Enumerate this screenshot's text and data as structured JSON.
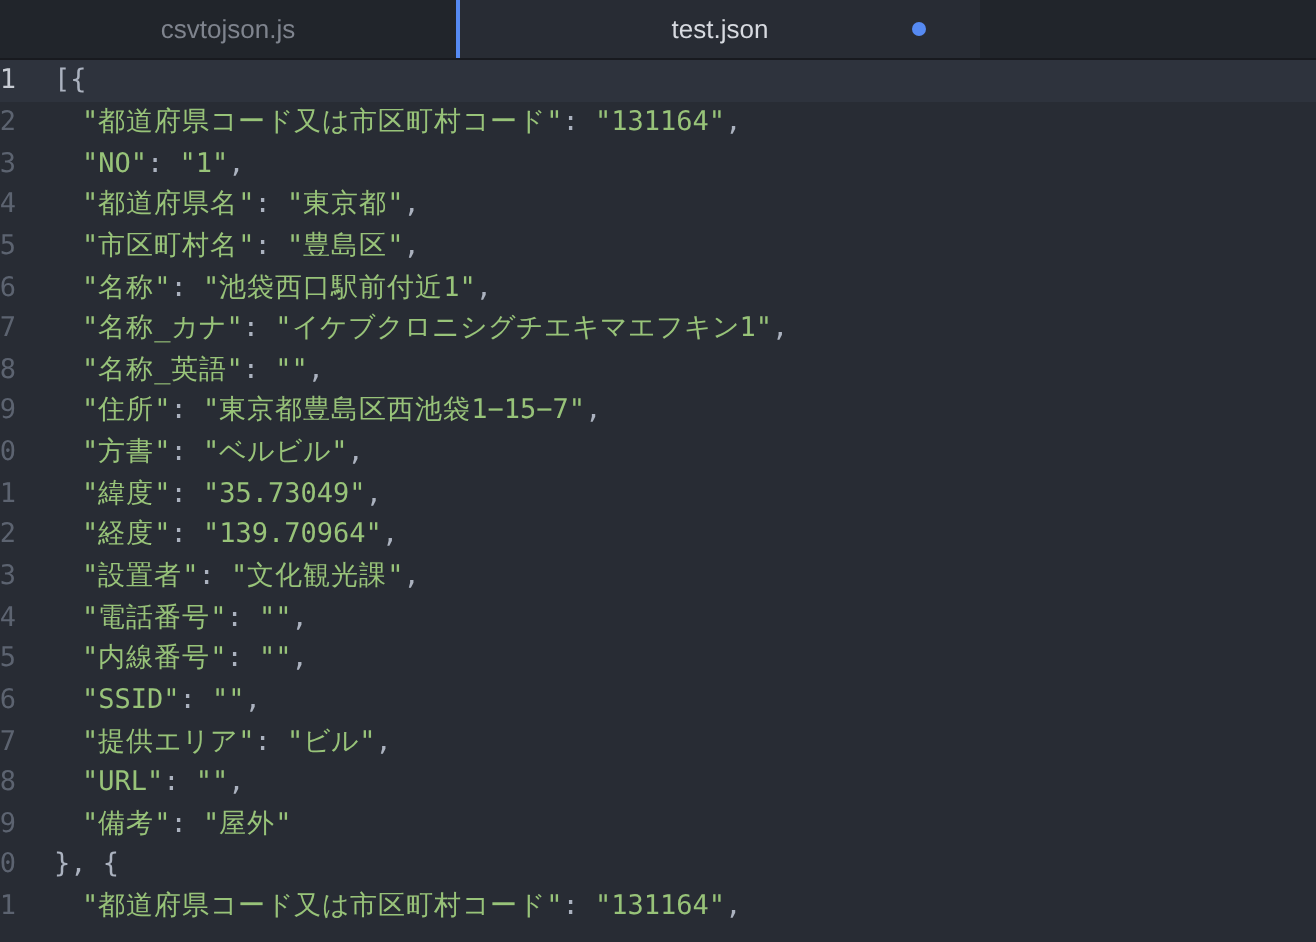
{
  "tabs": [
    {
      "label": "csvtojson.js",
      "selected": false,
      "modified": false
    },
    {
      "label": "test.json",
      "selected": true,
      "modified": true
    }
  ],
  "editor": {
    "lines": [
      {
        "number": "1",
        "current": true,
        "indented": false,
        "tokens": [
          {
            "t": "[{",
            "kind": "punct"
          }
        ]
      },
      {
        "number": "2",
        "current": false,
        "indented": true,
        "tokens": [
          {
            "t": "\"都道府県コード又は市区町村コード\"",
            "kind": "string"
          },
          {
            "t": ": ",
            "kind": "punct"
          },
          {
            "t": "\"131164\"",
            "kind": "string"
          },
          {
            "t": ",",
            "kind": "punct"
          }
        ]
      },
      {
        "number": "3",
        "current": false,
        "indented": true,
        "tokens": [
          {
            "t": "\"NO\"",
            "kind": "string"
          },
          {
            "t": ": ",
            "kind": "punct"
          },
          {
            "t": "\"1\"",
            "kind": "string"
          },
          {
            "t": ",",
            "kind": "punct"
          }
        ]
      },
      {
        "number": "4",
        "current": false,
        "indented": true,
        "tokens": [
          {
            "t": "\"都道府県名\"",
            "kind": "string"
          },
          {
            "t": ": ",
            "kind": "punct"
          },
          {
            "t": "\"東京都\"",
            "kind": "string"
          },
          {
            "t": ",",
            "kind": "punct"
          }
        ]
      },
      {
        "number": "5",
        "current": false,
        "indented": true,
        "tokens": [
          {
            "t": "\"市区町村名\"",
            "kind": "string"
          },
          {
            "t": ": ",
            "kind": "punct"
          },
          {
            "t": "\"豊島区\"",
            "kind": "string"
          },
          {
            "t": ",",
            "kind": "punct"
          }
        ]
      },
      {
        "number": "6",
        "current": false,
        "indented": true,
        "tokens": [
          {
            "t": "\"名称\"",
            "kind": "string"
          },
          {
            "t": ": ",
            "kind": "punct"
          },
          {
            "t": "\"池袋西口駅前付近1\"",
            "kind": "string"
          },
          {
            "t": ",",
            "kind": "punct"
          }
        ]
      },
      {
        "number": "7",
        "current": false,
        "indented": true,
        "tokens": [
          {
            "t": "\"名称_カナ\"",
            "kind": "string"
          },
          {
            "t": ": ",
            "kind": "punct"
          },
          {
            "t": "\"イケブクロニシグチエキマエフキン1\"",
            "kind": "string"
          },
          {
            "t": ",",
            "kind": "punct"
          }
        ]
      },
      {
        "number": "8",
        "current": false,
        "indented": true,
        "tokens": [
          {
            "t": "\"名称_英語\"",
            "kind": "string"
          },
          {
            "t": ": ",
            "kind": "punct"
          },
          {
            "t": "\"\"",
            "kind": "string"
          },
          {
            "t": ",",
            "kind": "punct"
          }
        ]
      },
      {
        "number": "9",
        "current": false,
        "indented": true,
        "tokens": [
          {
            "t": "\"住所\"",
            "kind": "string"
          },
          {
            "t": ": ",
            "kind": "punct"
          },
          {
            "t": "\"東京都豊島区西池袋1−15−7\"",
            "kind": "string"
          },
          {
            "t": ",",
            "kind": "punct"
          }
        ]
      },
      {
        "number": "0",
        "current": false,
        "indented": true,
        "tokens": [
          {
            "t": "\"方書\"",
            "kind": "string"
          },
          {
            "t": ": ",
            "kind": "punct"
          },
          {
            "t": "\"ベルビル\"",
            "kind": "string"
          },
          {
            "t": ",",
            "kind": "punct"
          }
        ]
      },
      {
        "number": "1",
        "current": false,
        "indented": true,
        "tokens": [
          {
            "t": "\"緯度\"",
            "kind": "string"
          },
          {
            "t": ": ",
            "kind": "punct"
          },
          {
            "t": "\"35.73049\"",
            "kind": "string"
          },
          {
            "t": ",",
            "kind": "punct"
          }
        ]
      },
      {
        "number": "2",
        "current": false,
        "indented": true,
        "tokens": [
          {
            "t": "\"経度\"",
            "kind": "string"
          },
          {
            "t": ": ",
            "kind": "punct"
          },
          {
            "t": "\"139.70964\"",
            "kind": "string"
          },
          {
            "t": ",",
            "kind": "punct"
          }
        ]
      },
      {
        "number": "3",
        "current": false,
        "indented": true,
        "tokens": [
          {
            "t": "\"設置者\"",
            "kind": "string"
          },
          {
            "t": ": ",
            "kind": "punct"
          },
          {
            "t": "\"文化観光課\"",
            "kind": "string"
          },
          {
            "t": ",",
            "kind": "punct"
          }
        ]
      },
      {
        "number": "4",
        "current": false,
        "indented": true,
        "tokens": [
          {
            "t": "\"電話番号\"",
            "kind": "string"
          },
          {
            "t": ": ",
            "kind": "punct"
          },
          {
            "t": "\"\"",
            "kind": "string"
          },
          {
            "t": ",",
            "kind": "punct"
          }
        ]
      },
      {
        "number": "5",
        "current": false,
        "indented": true,
        "tokens": [
          {
            "t": "\"内線番号\"",
            "kind": "string"
          },
          {
            "t": ": ",
            "kind": "punct"
          },
          {
            "t": "\"\"",
            "kind": "string"
          },
          {
            "t": ",",
            "kind": "punct"
          }
        ]
      },
      {
        "number": "6",
        "current": false,
        "indented": true,
        "tokens": [
          {
            "t": "\"SSID\"",
            "kind": "string"
          },
          {
            "t": ": ",
            "kind": "punct"
          },
          {
            "t": "\"\"",
            "kind": "string"
          },
          {
            "t": ",",
            "kind": "punct"
          }
        ]
      },
      {
        "number": "7",
        "current": false,
        "indented": true,
        "tokens": [
          {
            "t": "\"提供エリア\"",
            "kind": "string"
          },
          {
            "t": ": ",
            "kind": "punct"
          },
          {
            "t": "\"ビル\"",
            "kind": "string"
          },
          {
            "t": ",",
            "kind": "punct"
          }
        ]
      },
      {
        "number": "8",
        "current": false,
        "indented": true,
        "tokens": [
          {
            "t": "\"URL\"",
            "kind": "string"
          },
          {
            "t": ": ",
            "kind": "punct"
          },
          {
            "t": "\"\"",
            "kind": "string"
          },
          {
            "t": ",",
            "kind": "punct"
          }
        ]
      },
      {
        "number": "9",
        "current": false,
        "indented": true,
        "tokens": [
          {
            "t": "\"備考\"",
            "kind": "string"
          },
          {
            "t": ": ",
            "kind": "punct"
          },
          {
            "t": "\"屋外\"",
            "kind": "string"
          }
        ]
      },
      {
        "number": "0",
        "current": false,
        "indented": false,
        "tokens": [
          {
            "t": "}, {",
            "kind": "punct"
          }
        ]
      },
      {
        "number": "1",
        "current": false,
        "indented": true,
        "tokens": [
          {
            "t": "\"都道府県コード又は市区町村コード\"",
            "kind": "string"
          },
          {
            "t": ": ",
            "kind": "punct"
          },
          {
            "t": "\"131164\"",
            "kind": "string"
          },
          {
            "t": ",",
            "kind": "punct"
          }
        ]
      }
    ]
  }
}
